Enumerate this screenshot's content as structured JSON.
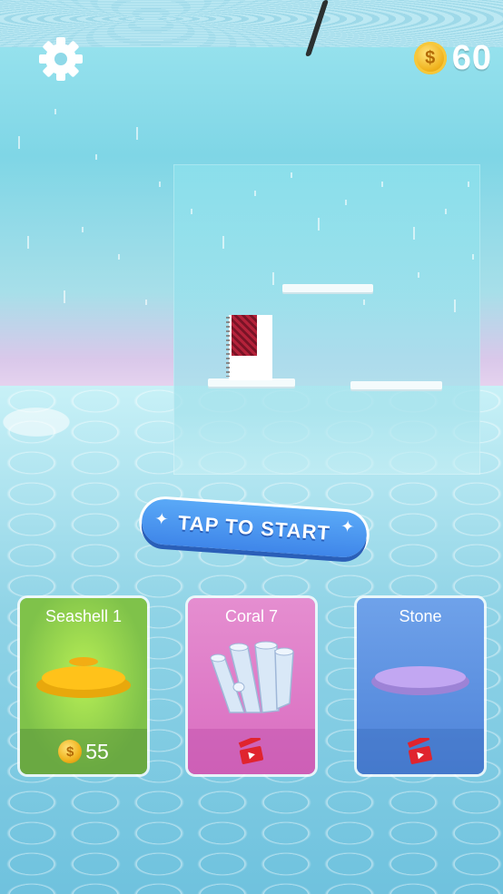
{
  "hud": {
    "coin_count": "60",
    "coin_symbol": "$"
  },
  "start_button": {
    "label": "TAP TO START"
  },
  "cards": [
    {
      "title": "Seashell 1",
      "price": "55",
      "unlock": "coins",
      "color": "#7fc24a"
    },
    {
      "title": "Coral 7",
      "unlock": "video-ad",
      "color": "#dd74c4"
    },
    {
      "title": "Stone",
      "unlock": "video-ad",
      "color": "#5b8ee0"
    }
  ],
  "icons": {
    "settings": "gear-icon",
    "coin": "coin-icon",
    "video": "video-clapper-icon"
  },
  "colors": {
    "accent": "#3f86e9",
    "coin": "#f0b21c"
  }
}
